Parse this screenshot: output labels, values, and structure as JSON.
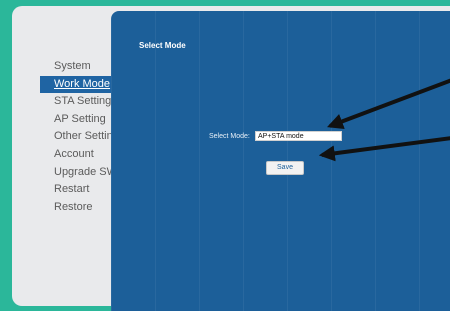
{
  "sidebar": {
    "items": [
      {
        "label": "System"
      },
      {
        "label": "Work Mode"
      },
      {
        "label": "STA Setting"
      },
      {
        "label": "AP Setting"
      },
      {
        "label": "Other Setting"
      },
      {
        "label": "Account"
      },
      {
        "label": "Upgrade SW"
      },
      {
        "label": "Restart"
      },
      {
        "label": "Restore"
      }
    ],
    "active_index": 1
  },
  "panel": {
    "title": "Select Mode",
    "select_label": "Select Mode:",
    "select_value": "AP+STA mode",
    "save_label": "Save"
  },
  "colors": {
    "page_background": "#2bb79a",
    "sidebar_background": "#e9eaec",
    "panel_background": "#1c5f99",
    "active_item": "#1f64a3"
  },
  "icons": [
    "annotation-arrow"
  ]
}
